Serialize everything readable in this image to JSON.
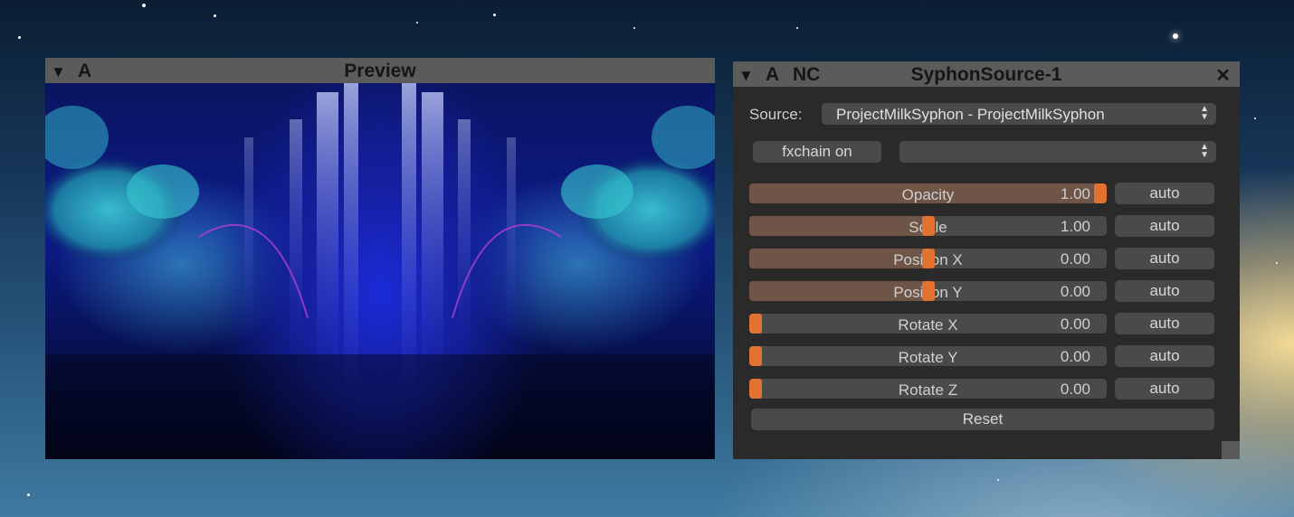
{
  "preview": {
    "collapse_arrow": "▼",
    "flag": "A",
    "title": "Preview"
  },
  "syphon": {
    "collapse_arrow": "▼",
    "flag_a": "A",
    "flag_nc": "NC",
    "title": "SyphonSource-1",
    "close": "✕",
    "source_label": "Source:",
    "source_value": "ProjectMilkSyphon - ProjectMilkSyphon",
    "fxchain_button": "fxchain on",
    "fxchain_select": "",
    "sliders": [
      {
        "label": "Opacity",
        "value": "1.00",
        "fraction": 1.0,
        "auto": "auto"
      },
      {
        "label": "Scale",
        "value": "1.00",
        "fraction": 0.5,
        "auto": "auto"
      },
      {
        "label": "Position X",
        "value": "0.00",
        "fraction": 0.5,
        "auto": "auto"
      },
      {
        "label": "Position Y",
        "value": "0.00",
        "fraction": 0.5,
        "auto": "auto"
      },
      {
        "label": "Rotate X",
        "value": "0.00",
        "fraction": 0.0,
        "auto": "auto"
      },
      {
        "label": "Rotate Y",
        "value": "0.00",
        "fraction": 0.0,
        "auto": "auto"
      },
      {
        "label": "Rotate Z",
        "value": "0.00",
        "fraction": 0.0,
        "auto": "auto"
      }
    ],
    "reset_button": "Reset"
  },
  "colors": {
    "accent": "#e2722f",
    "fill": "#6f5548",
    "titlebar": "#5b5b5b",
    "panel": "#2a2a2a"
  }
}
